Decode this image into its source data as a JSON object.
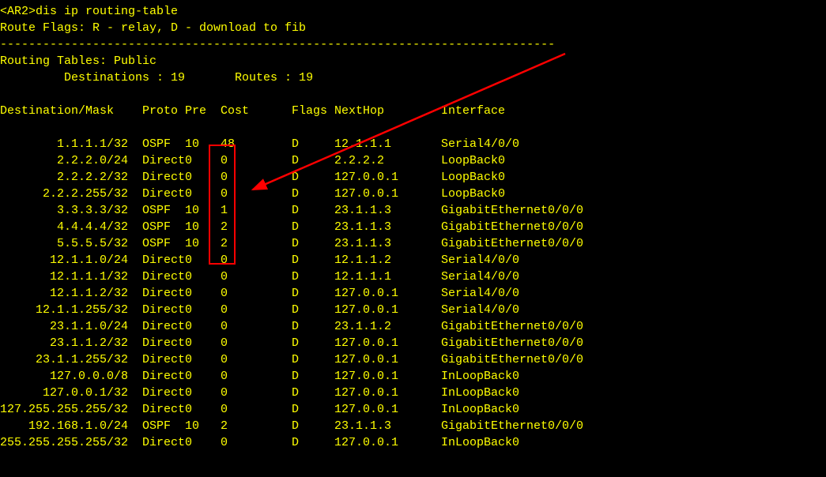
{
  "prompt_line": "<AR2>dis ip routing-table",
  "flags_line": "Route Flags: R - relay, D - download to fib",
  "divider": "------------------------------------------------------------------------------",
  "tables_line": "Routing Tables: Public",
  "summary_line": "         Destinations : 19       Routes : 19",
  "headers": {
    "dest": "Destination/Mask",
    "proto": "Proto",
    "pre": "Pre",
    "cost": "Cost",
    "flags": "Flags",
    "nexthop": "NextHop",
    "interface": "Interface"
  },
  "routes": [
    {
      "dest": "1.1.1.1/32",
      "proto": "OSPF",
      "pre": "10",
      "cost": "48",
      "flags": "D",
      "nexthop": "12.1.1.1",
      "intf": "Serial4/0/0"
    },
    {
      "dest": "2.2.2.0/24",
      "proto": "Direct",
      "pre": "0",
      "cost": "0",
      "flags": "D",
      "nexthop": "2.2.2.2",
      "intf": "LoopBack0"
    },
    {
      "dest": "2.2.2.2/32",
      "proto": "Direct",
      "pre": "0",
      "cost": "0",
      "flags": "D",
      "nexthop": "127.0.0.1",
      "intf": "LoopBack0"
    },
    {
      "dest": "2.2.2.255/32",
      "proto": "Direct",
      "pre": "0",
      "cost": "0",
      "flags": "D",
      "nexthop": "127.0.0.1",
      "intf": "LoopBack0"
    },
    {
      "dest": "3.3.3.3/32",
      "proto": "OSPF",
      "pre": "10",
      "cost": "1",
      "flags": "D",
      "nexthop": "23.1.1.3",
      "intf": "GigabitEthernet0/0/0"
    },
    {
      "dest": "4.4.4.4/32",
      "proto": "OSPF",
      "pre": "10",
      "cost": "2",
      "flags": "D",
      "nexthop": "23.1.1.3",
      "intf": "GigabitEthernet0/0/0"
    },
    {
      "dest": "5.5.5.5/32",
      "proto": "OSPF",
      "pre": "10",
      "cost": "2",
      "flags": "D",
      "nexthop": "23.1.1.3",
      "intf": "GigabitEthernet0/0/0"
    },
    {
      "dest": "12.1.1.0/24",
      "proto": "Direct",
      "pre": "0",
      "cost": "0",
      "flags": "D",
      "nexthop": "12.1.1.2",
      "intf": "Serial4/0/0"
    },
    {
      "dest": "12.1.1.1/32",
      "proto": "Direct",
      "pre": "0",
      "cost": "0",
      "flags": "D",
      "nexthop": "12.1.1.1",
      "intf": "Serial4/0/0"
    },
    {
      "dest": "12.1.1.2/32",
      "proto": "Direct",
      "pre": "0",
      "cost": "0",
      "flags": "D",
      "nexthop": "127.0.0.1",
      "intf": "Serial4/0/0"
    },
    {
      "dest": "12.1.1.255/32",
      "proto": "Direct",
      "pre": "0",
      "cost": "0",
      "flags": "D",
      "nexthop": "127.0.0.1",
      "intf": "Serial4/0/0"
    },
    {
      "dest": "23.1.1.0/24",
      "proto": "Direct",
      "pre": "0",
      "cost": "0",
      "flags": "D",
      "nexthop": "23.1.1.2",
      "intf": "GigabitEthernet0/0/0"
    },
    {
      "dest": "23.1.1.2/32",
      "proto": "Direct",
      "pre": "0",
      "cost": "0",
      "flags": "D",
      "nexthop": "127.0.0.1",
      "intf": "GigabitEthernet0/0/0"
    },
    {
      "dest": "23.1.1.255/32",
      "proto": "Direct",
      "pre": "0",
      "cost": "0",
      "flags": "D",
      "nexthop": "127.0.0.1",
      "intf": "GigabitEthernet0/0/0"
    },
    {
      "dest": "127.0.0.0/8",
      "proto": "Direct",
      "pre": "0",
      "cost": "0",
      "flags": "D",
      "nexthop": "127.0.0.1",
      "intf": "InLoopBack0"
    },
    {
      "dest": "127.0.0.1/32",
      "proto": "Direct",
      "pre": "0",
      "cost": "0",
      "flags": "D",
      "nexthop": "127.0.0.1",
      "intf": "InLoopBack0"
    },
    {
      "dest": "127.255.255.255/32",
      "proto": "Direct",
      "pre": "0",
      "cost": "0",
      "flags": "D",
      "nexthop": "127.0.0.1",
      "intf": "InLoopBack0"
    },
    {
      "dest": "192.168.1.0/24",
      "proto": "OSPF",
      "pre": "10",
      "cost": "2",
      "flags": "D",
      "nexthop": "23.1.1.3",
      "intf": "GigabitEthernet0/0/0"
    },
    {
      "dest": "255.255.255.255/32",
      "proto": "Direct",
      "pre": "0",
      "cost": "0",
      "flags": "D",
      "nexthop": "127.0.0.1",
      "intf": "InLoopBack0"
    }
  ]
}
